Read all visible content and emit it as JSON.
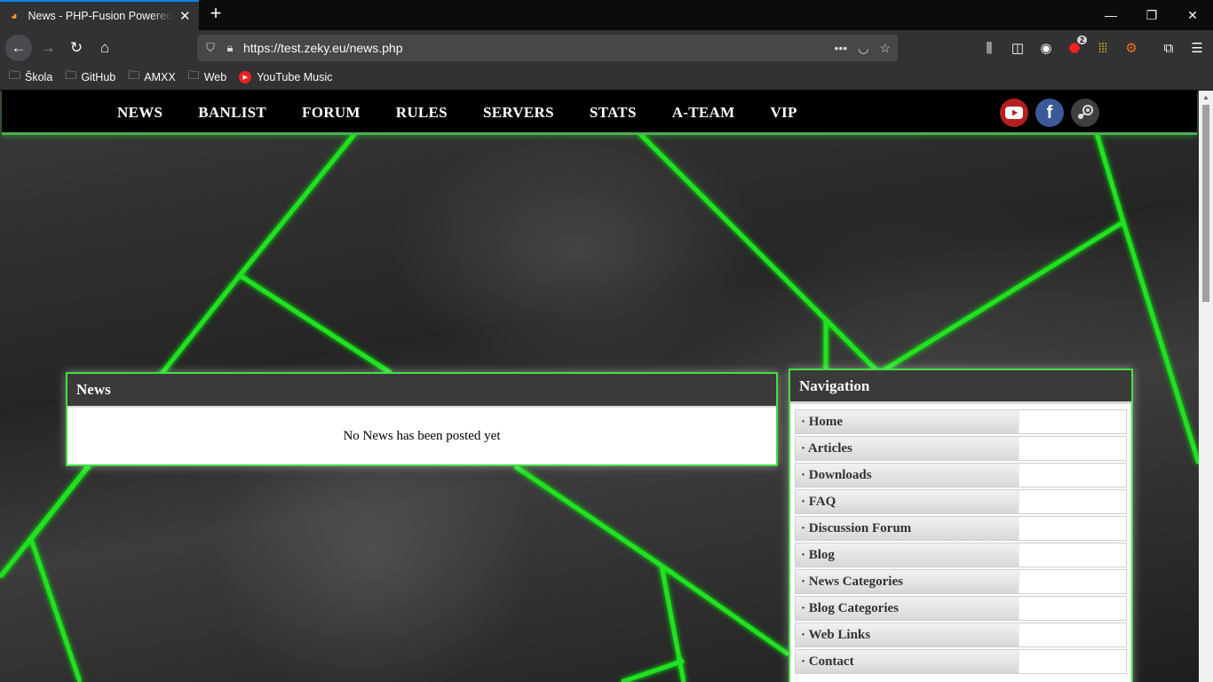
{
  "browser": {
    "tab_title": "News - PHP-Fusion Powered Website",
    "url": "https://test.zeky.eu/news.php",
    "extension_badge": "2",
    "bookmarks": [
      "Škola",
      "GitHub",
      "AMXX",
      "Web",
      "YouTube Music"
    ]
  },
  "site": {
    "nav": [
      "NEWS",
      "BANLIST",
      "FORUM",
      "RULES",
      "SERVERS",
      "STATS",
      "A-TEAM",
      "VIP"
    ],
    "social": [
      "youtube-icon",
      "facebook-icon",
      "steam-icon"
    ],
    "accent_color": "#40e040"
  },
  "news_panel": {
    "title": "News",
    "message": "No News has been posted yet"
  },
  "navigation_panel": {
    "title": "Navigation",
    "items": [
      "· Home",
      "· Articles",
      "· Downloads",
      "· FAQ",
      "· Discussion Forum",
      "· Blog",
      "· News Categories",
      "· Blog Categories",
      "· Web Links",
      "· Contact"
    ]
  }
}
